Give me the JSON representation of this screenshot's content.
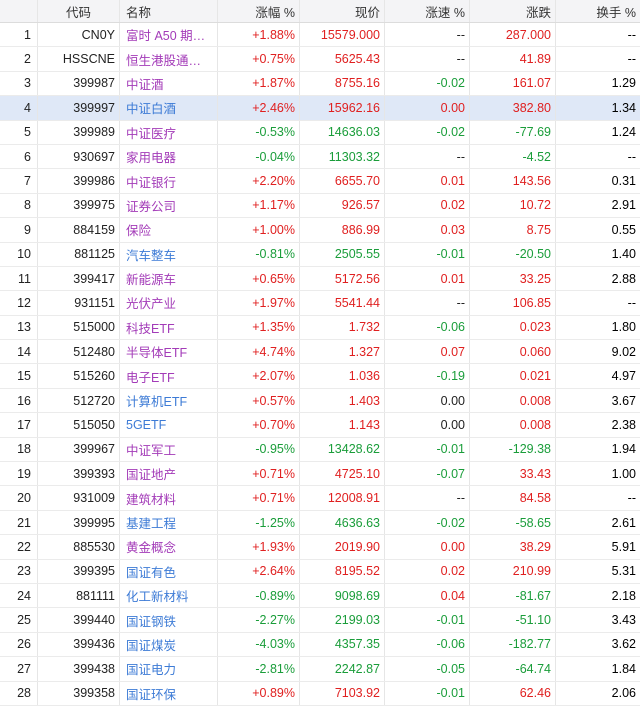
{
  "colors": {
    "up": "#e02020",
    "down": "#1a9d3a",
    "name_highlight": "#a33bb8",
    "name_default": "#3d7bd6",
    "selected_row": "#dfe8f7"
  },
  "headers": {
    "code": "代码",
    "name": "名称",
    "pct": "涨幅 %",
    "price": "现价",
    "speed": "涨速 %",
    "change": "涨跌",
    "turnover": "换手 %"
  },
  "rows": [
    {
      "idx": "1",
      "code": "CN0Y",
      "name": "富时 A50 期…",
      "pct": "+1.88%",
      "price": "15579.000",
      "speed": "--",
      "change": "287.000",
      "turnover": "--",
      "dir": "up",
      "name_style": "purple",
      "speed_dir": "neutral"
    },
    {
      "idx": "2",
      "code": "HSSCNE",
      "name": "恒生港股通…",
      "pct": "+0.75%",
      "price": "5625.43",
      "speed": "--",
      "change": "41.89",
      "turnover": "--",
      "dir": "up",
      "name_style": "purple",
      "speed_dir": "neutral"
    },
    {
      "idx": "3",
      "code": "399987",
      "name": "中证酒",
      "pct": "+1.87%",
      "price": "8755.16",
      "speed": "-0.02",
      "change": "161.07",
      "turnover": "1.29",
      "dir": "up",
      "name_style": "purple",
      "speed_dir": "down"
    },
    {
      "idx": "4",
      "code": "399997",
      "name": "中证白酒",
      "pct": "+2.46%",
      "price": "15962.16",
      "speed": "0.00",
      "change": "382.80",
      "turnover": "1.34",
      "dir": "up",
      "name_style": "blue",
      "speed_dir": "up",
      "selected": true
    },
    {
      "idx": "5",
      "code": "399989",
      "name": "中证医疗",
      "pct": "-0.53%",
      "price": "14636.03",
      "speed": "-0.02",
      "change": "-77.69",
      "turnover": "1.24",
      "dir": "down",
      "name_style": "purple",
      "speed_dir": "down"
    },
    {
      "idx": "6",
      "code": "930697",
      "name": "家用电器",
      "pct": "-0.04%",
      "price": "11303.32",
      "speed": "--",
      "change": "-4.52",
      "turnover": "--",
      "dir": "down",
      "name_style": "purple",
      "speed_dir": "neutral"
    },
    {
      "idx": "7",
      "code": "399986",
      "name": "中证银行",
      "pct": "+2.20%",
      "price": "6655.70",
      "speed": "0.01",
      "change": "143.56",
      "turnover": "0.31",
      "dir": "up",
      "name_style": "purple",
      "speed_dir": "up"
    },
    {
      "idx": "8",
      "code": "399975",
      "name": "证券公司",
      "pct": "+1.17%",
      "price": "926.57",
      "speed": "0.02",
      "change": "10.72",
      "turnover": "2.91",
      "dir": "up",
      "name_style": "purple",
      "speed_dir": "up"
    },
    {
      "idx": "9",
      "code": "884159",
      "name": "保险",
      "pct": "+1.00%",
      "price": "886.99",
      "speed": "0.03",
      "change": "8.75",
      "turnover": "0.55",
      "dir": "up",
      "name_style": "purple",
      "speed_dir": "up"
    },
    {
      "idx": "10",
      "code": "881125",
      "name": "汽车整车",
      "pct": "-0.81%",
      "price": "2505.55",
      "speed": "-0.01",
      "change": "-20.50",
      "turnover": "1.40",
      "dir": "down",
      "name_style": "blue",
      "speed_dir": "down"
    },
    {
      "idx": "11",
      "code": "399417",
      "name": "新能源车",
      "pct": "+0.65%",
      "price": "5172.56",
      "speed": "0.01",
      "change": "33.25",
      "turnover": "2.88",
      "dir": "up",
      "name_style": "purple",
      "speed_dir": "up"
    },
    {
      "idx": "12",
      "code": "931151",
      "name": "光伏产业",
      "pct": "+1.97%",
      "price": "5541.44",
      "speed": "--",
      "change": "106.85",
      "turnover": "--",
      "dir": "up",
      "name_style": "purple",
      "speed_dir": "neutral"
    },
    {
      "idx": "13",
      "code": "515000",
      "name": "科技ETF",
      "pct": "+1.35%",
      "price": "1.732",
      "speed": "-0.06",
      "change": "0.023",
      "turnover": "1.80",
      "dir": "up",
      "name_style": "purple",
      "speed_dir": "down"
    },
    {
      "idx": "14",
      "code": "512480",
      "name": "半导体ETF",
      "pct": "+4.74%",
      "price": "1.327",
      "speed": "0.07",
      "change": "0.060",
      "turnover": "9.02",
      "dir": "up",
      "name_style": "purple",
      "speed_dir": "up"
    },
    {
      "idx": "15",
      "code": "515260",
      "name": "电子ETF",
      "pct": "+2.07%",
      "price": "1.036",
      "speed": "-0.19",
      "change": "0.021",
      "turnover": "4.97",
      "dir": "up",
      "name_style": "purple",
      "speed_dir": "down"
    },
    {
      "idx": "16",
      "code": "512720",
      "name": "计算机ETF",
      "pct": "+0.57%",
      "price": "1.403",
      "speed": "0.00",
      "change": "0.008",
      "turnover": "3.67",
      "dir": "up",
      "name_style": "blue",
      "speed_dir": "neutral"
    },
    {
      "idx": "17",
      "code": "515050",
      "name": "5GETF",
      "pct": "+0.70%",
      "price": "1.143",
      "speed": "0.00",
      "change": "0.008",
      "turnover": "2.38",
      "dir": "up",
      "name_style": "blue",
      "speed_dir": "neutral"
    },
    {
      "idx": "18",
      "code": "399967",
      "name": "中证军工",
      "pct": "-0.95%",
      "price": "13428.62",
      "speed": "-0.01",
      "change": "-129.38",
      "turnover": "1.94",
      "dir": "down",
      "name_style": "purple",
      "speed_dir": "down"
    },
    {
      "idx": "19",
      "code": "399393",
      "name": "国证地产",
      "pct": "+0.71%",
      "price": "4725.10",
      "speed": "-0.07",
      "change": "33.43",
      "turnover": "1.00",
      "dir": "up",
      "name_style": "purple",
      "speed_dir": "down"
    },
    {
      "idx": "20",
      "code": "931009",
      "name": "建筑材料",
      "pct": "+0.71%",
      "price": "12008.91",
      "speed": "--",
      "change": "84.58",
      "turnover": "--",
      "dir": "up",
      "name_style": "purple",
      "speed_dir": "neutral"
    },
    {
      "idx": "21",
      "code": "399995",
      "name": "基建工程",
      "pct": "-1.25%",
      "price": "4636.63",
      "speed": "-0.02",
      "change": "-58.65",
      "turnover": "2.61",
      "dir": "down",
      "name_style": "blue",
      "speed_dir": "down"
    },
    {
      "idx": "22",
      "code": "885530",
      "name": "黄金概念",
      "pct": "+1.93%",
      "price": "2019.90",
      "speed": "0.00",
      "change": "38.29",
      "turnover": "5.91",
      "dir": "up",
      "name_style": "purple",
      "speed_dir": "up"
    },
    {
      "idx": "23",
      "code": "399395",
      "name": "国证有色",
      "pct": "+2.64%",
      "price": "8195.52",
      "speed": "0.02",
      "change": "210.99",
      "turnover": "5.31",
      "dir": "up",
      "name_style": "blue",
      "speed_dir": "up"
    },
    {
      "idx": "24",
      "code": "881111",
      "name": "化工新材料",
      "pct": "-0.89%",
      "price": "9098.69",
      "speed": "0.04",
      "change": "-81.67",
      "turnover": "2.18",
      "dir": "down",
      "name_style": "blue",
      "speed_dir": "up"
    },
    {
      "idx": "25",
      "code": "399440",
      "name": "国证钢铁",
      "pct": "-2.27%",
      "price": "2199.03",
      "speed": "-0.01",
      "change": "-51.10",
      "turnover": "3.43",
      "dir": "down",
      "name_style": "blue",
      "speed_dir": "down"
    },
    {
      "idx": "26",
      "code": "399436",
      "name": "国证煤炭",
      "pct": "-4.03%",
      "price": "4357.35",
      "speed": "-0.06",
      "change": "-182.77",
      "turnover": "3.62",
      "dir": "down",
      "name_style": "blue",
      "speed_dir": "down"
    },
    {
      "idx": "27",
      "code": "399438",
      "name": "国证电力",
      "pct": "-2.81%",
      "price": "2242.87",
      "speed": "-0.05",
      "change": "-64.74",
      "turnover": "1.84",
      "dir": "down",
      "name_style": "blue",
      "speed_dir": "down"
    },
    {
      "idx": "28",
      "code": "399358",
      "name": "国证环保",
      "pct": "+0.89%",
      "price": "7103.92",
      "speed": "-0.01",
      "change": "62.46",
      "turnover": "2.06",
      "dir": "up",
      "name_style": "blue",
      "speed_dir": "down"
    }
  ]
}
